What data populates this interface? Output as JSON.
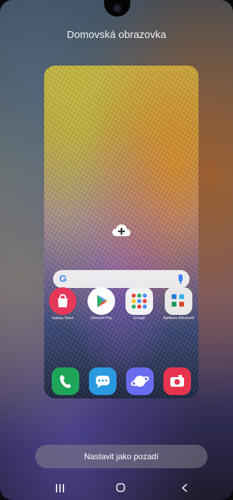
{
  "screen_title": "Domovská obrazovka",
  "preview": {
    "search": {
      "google_glyph": "G"
    },
    "apps_row1": [
      {
        "name": "galaxy-store",
        "label": "Galaxy Store",
        "color": "#e6385a"
      },
      {
        "name": "google-play",
        "label": "Obchod Play",
        "color": "#ffffff"
      },
      {
        "name": "google-folder",
        "label": "Google",
        "color": "#f2f2f2"
      },
      {
        "name": "microsoft-folder",
        "label": "Aplikace Microsoft",
        "color": "#e8e8e8"
      }
    ],
    "dock": [
      {
        "name": "phone",
        "color": "#1fa55a"
      },
      {
        "name": "messages",
        "color": "#2a9ae0"
      },
      {
        "name": "internet",
        "color": "#6a6cf0"
      },
      {
        "name": "camera",
        "color": "#e8334e"
      }
    ]
  },
  "set_wallpaper_button": "Nastavit jako pozadí",
  "nav": {
    "recent": "III",
    "home": "O",
    "back": "<"
  }
}
